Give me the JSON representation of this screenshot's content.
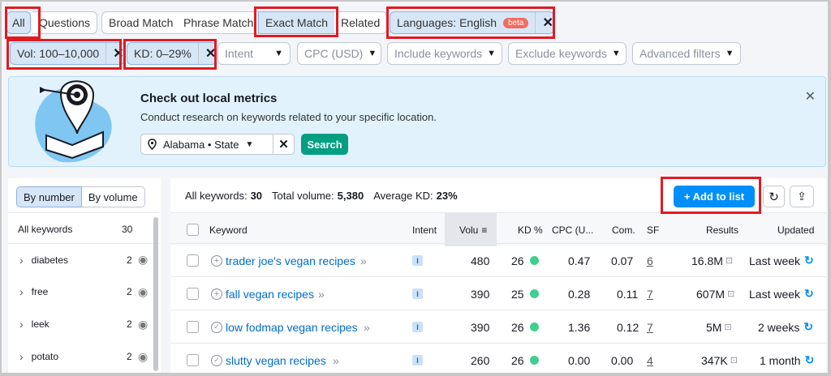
{
  "filters": {
    "tabs": [
      {
        "label": "All",
        "selected": true
      },
      {
        "label": "Questions",
        "selected": false
      },
      {
        "label": "Broad Match",
        "selected": false
      },
      {
        "label": "Phrase Match",
        "selected": false
      },
      {
        "label": "Exact Match",
        "selected": true
      },
      {
        "label": "Related",
        "selected": false
      }
    ],
    "language_label": "Languages: English",
    "beta_badge": "beta",
    "vol_chip": "Vol: 100–10,000",
    "kd_chip": "KD: 0–29%",
    "intent": "Intent",
    "cpc": "CPC (USD)",
    "include": "Include keywords",
    "exclude": "Exclude keywords",
    "advanced": "Advanced filters"
  },
  "banner": {
    "title": "Check out local metrics",
    "subtitle": "Conduct research on keywords related to your specific location.",
    "location_value": "Alabama • State",
    "search_label": "Search",
    "close_icon": "close-icon"
  },
  "sidebar": {
    "toggle": [
      "By number",
      "By volume"
    ],
    "header_label": "All keywords",
    "header_count": "30",
    "items": [
      {
        "label": "diabetes",
        "count": "2"
      },
      {
        "label": "free",
        "count": "2"
      },
      {
        "label": "leek",
        "count": "2"
      },
      {
        "label": "potato",
        "count": "2"
      }
    ]
  },
  "summary": {
    "all_keywords_label": "All keywords:",
    "all_keywords_value": "30",
    "total_volume_label": "Total volume:",
    "total_volume_value": "5,380",
    "avg_kd_label": "Average KD:",
    "avg_kd_value": "23%",
    "add_to_list": "+ Add to list"
  },
  "table": {
    "columns": [
      "Keyword",
      "Intent",
      "Volu",
      "KD %",
      "CPC (U...",
      "Com.",
      "SF",
      "Results",
      "Updated"
    ],
    "rows": [
      {
        "keyword": "trader joe's vegan recipes",
        "status_icon": "plus-circle-icon",
        "intent": "I",
        "volume": "480",
        "kd": "26",
        "cpc": "0.47",
        "com": "0.07",
        "sf": "6",
        "results": "16.8M",
        "updated": "Last week"
      },
      {
        "keyword": "fall vegan recipes",
        "status_icon": "plus-circle-icon",
        "intent": "I",
        "volume": "390",
        "kd": "25",
        "cpc": "0.28",
        "com": "0.11",
        "sf": "7",
        "results": "607M",
        "updated": "Last week"
      },
      {
        "keyword": "low fodmap vegan recipes",
        "status_icon": "check-circle-icon",
        "intent": "I",
        "volume": "390",
        "kd": "26",
        "cpc": "1.36",
        "com": "0.12",
        "sf": "7",
        "results": "5M",
        "updated": "2 weeks"
      },
      {
        "keyword": "slutty vegan recipes",
        "status_icon": "check-circle-icon",
        "intent": "I",
        "volume": "260",
        "kd": "26",
        "cpc": "0.00",
        "com": "0.00",
        "sf": "4",
        "results": "347K",
        "updated": "1 month"
      }
    ]
  },
  "colors": {
    "accent_blue": "#006dca",
    "highlight_red": "#e01b22",
    "kd_green": "#3ecf8e",
    "banner_bg": "#e1f2fd",
    "search_green": "#009f81"
  }
}
